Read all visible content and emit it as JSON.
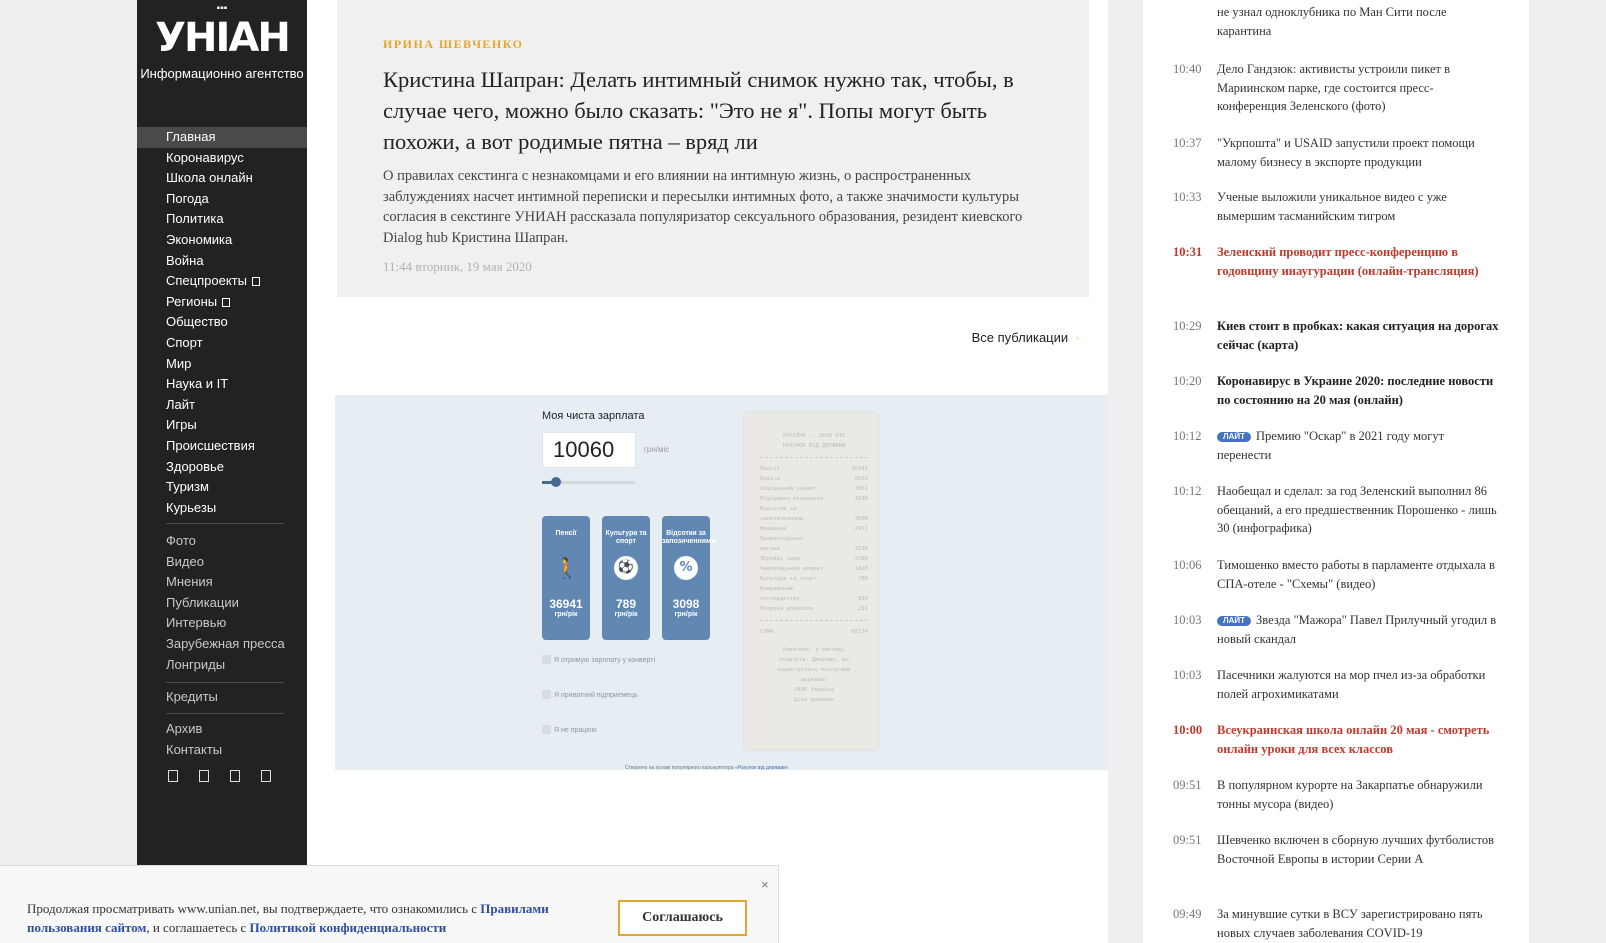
{
  "brand": {
    "logo": "УНІАН",
    "logo_dots": "▪▪▪",
    "subtitle": "Информационно агентство"
  },
  "sidebar": {
    "main_nav": [
      {
        "label": "Главная",
        "active": true
      },
      {
        "label": "Коронавирус"
      },
      {
        "label": "Школа онлайн"
      },
      {
        "label": "Погода"
      },
      {
        "label": "Политика"
      },
      {
        "label": "Экономика"
      },
      {
        "label": "Война"
      },
      {
        "label": "Спецпроекты",
        "submenu": true
      },
      {
        "label": "Регионы",
        "submenu": true
      },
      {
        "label": "Общество"
      },
      {
        "label": "Спорт"
      },
      {
        "label": "Мир"
      },
      {
        "label": "Наука и IT"
      },
      {
        "label": "Лайт"
      },
      {
        "label": "Игры"
      },
      {
        "label": "Происшествия"
      },
      {
        "label": "Здоровье"
      },
      {
        "label": "Туризм"
      },
      {
        "label": "Курьезы"
      }
    ],
    "secondary_nav": [
      "Фото",
      "Видео",
      "Мнения",
      "Публикации",
      "Интервью",
      "Зарубежная пресса",
      "Лонгриды"
    ],
    "credits": "Кредиты",
    "footer_nav": [
      "Архив",
      "Контакты"
    ]
  },
  "article": {
    "author": "Ирина Шевченко",
    "headline": "Кристина Шапран: Делать интимный снимок нужно так, чтобы, в случае чего, можно было сказать: \"Это не я\". Попы могут быть похожи, а вот родимые пятна – вряд ли",
    "lead": "О правилах секстинга с незнакомцами и его влиянии на интимную жизнь, о распространенных заблуждениях насчет интимной переписки и пересылки интимных фото, а также значимости культуры согласия в секстинге УНИАН рассказала популяризатор сексуального образования, резидент киевского Dialog hub Кристина Шапран.",
    "timestamp": "11:44 вторник, 19 мая 2020"
  },
  "all_publications": {
    "label": "Все публикации",
    "arrow": "▫"
  },
  "widget": {
    "label": "Моя чиста зарплата",
    "salary_value": "10060",
    "unit": "грн/міс",
    "slider_level": 0.15,
    "cards": [
      {
        "title": "Пенсії",
        "value": "36941",
        "unit": "грн/рік",
        "icon": "elderly-icon",
        "glyph": "🚶"
      },
      {
        "title": "Культура та спорт",
        "value": "789",
        "unit": "грн/рік",
        "icon": "ball-icon",
        "glyph": "⚽"
      },
      {
        "title": "Відсотки за запозиченнями",
        "value": "3098",
        "unit": "грн/рік",
        "icon": "percent-icon",
        "glyph": "%"
      }
    ],
    "checkboxes": [
      "Я отримую зарплату у конверті",
      "Я приватний підприємець",
      "Я не працюю"
    ],
    "receipt": {
      "header1": "УКРАЇНА -- 2020 РІК",
      "header2": "РАХУНОК ВІД ДЕРЖАВИ",
      "lines": [
        {
          "name": "Пенсії",
          "value": "36941"
        },
        {
          "name": "Освіта",
          "value": "5593"
        },
        {
          "name": "Соціальний захист",
          "value": "3051"
        },
        {
          "name": "Підтримка економіки",
          "value": "4030"
        },
        {
          "name": "Відсотки за",
          "value": ""
        },
        {
          "name": "запозиченнями",
          "value": "3098"
        },
        {
          "name": "Медицина",
          "value": "2971"
        },
        {
          "name": "Правоохоронні",
          "value": ""
        },
        {
          "name": "органи",
          "value": "3230"
        },
        {
          "name": "Збройні сили",
          "value": "2580"
        },
        {
          "name": "Чиновницький апарат",
          "value": "1620"
        },
        {
          "name": "Культура та спорт",
          "value": "789"
        },
        {
          "name": "Комунальне",
          "value": ""
        },
        {
          "name": "господарство",
          "value": "839"
        },
        {
          "name": "Охорона довкілля",
          "value": "231"
        }
      ],
      "total_label": "СУМА",
      "total_value": "65174",
      "footer_lines": [
        "Оплачено: у вигляді",
        "податків. Дякуємо, що",
        "користуєтесь послугами",
        "держави!",
        "СКОЄ Україна",
        "Ціна держави"
      ]
    },
    "footer_text": "Створено на основі популярного калькулятора",
    "footer_link": "«Рахунок від держави»"
  },
  "news": [
    {
      "time": "",
      "text": "не узнал одноклубника по Ман Сити после карантина",
      "style": "normal"
    },
    {
      "time": "10:40",
      "text": "Дело Гандзюк: активисты устроили пикет в Мариинском парке, где состоится пресс-конференция Зеленского (фото)",
      "style": "normal"
    },
    {
      "time": "10:37",
      "text": "\"Укрпошта\" и USAID запустили проект помощи малому бизнесу в экспорте продукции",
      "style": "normal"
    },
    {
      "time": "10:33",
      "text": "Ученые выложили уникальное видео с уже вымершим тасманийским тигром",
      "style": "normal"
    },
    {
      "time": "10:31",
      "text": "Зеленский проводит пресс-конференцию в годовщину инаугурации (онлайн-трансляция)",
      "style": "red"
    },
    {
      "time": "10:29",
      "text": "Киев стоит в пробках: какая ситуация на дорогах сейчас (карта)",
      "style": "bold"
    },
    {
      "time": "10:20",
      "text": "Коронавирус в Украине 2020: последние новости по состоянию на 20 мая (онлайн)",
      "style": "bold"
    },
    {
      "time": "10:12",
      "badge": "ЛАЙТ",
      "text": "Премию \"Оскар\" в 2021 году могут перенести",
      "style": "normal"
    },
    {
      "time": "10:12",
      "text": "Наобещал и сделал: за год Зеленский выполнил 86 обещаний, а его предшественник Порошенко - лишь 30 (инфографика)",
      "style": "normal"
    },
    {
      "time": "10:06",
      "text": "Тимошенко вместо работы в парламенте отдыхала в СПА-отеле - \"Схемы\" (видео)",
      "style": "normal"
    },
    {
      "time": "10:03",
      "badge": "ЛАЙТ",
      "text": "Звезда \"Мажора\" Павел Прилучный угодил в новый скандал",
      "style": "normal"
    },
    {
      "time": "10:03",
      "text": "Пасечники жалуются на мор пчел из-за обработки полей агрохимикатами",
      "style": "normal"
    },
    {
      "time": "10:00",
      "text": "Всеукраинская школа онлайн 20 мая - смотреть онлайн уроки для всех классов",
      "style": "red"
    },
    {
      "time": "09:51",
      "text": "В популярном курорте на Закарпатье обнаружили тонны мусора (видео)",
      "style": "normal"
    },
    {
      "time": "09:51",
      "text": "Шевченко включен в сборную лучших футболистов Восточной Европы в истории Серии А",
      "style": "normal"
    },
    {
      "time": "09:49",
      "text": "За минувшие сутки в ВСУ зарегистрировано пять новых случаев заболевания COVID-19",
      "style": "normal"
    }
  ],
  "cookie": {
    "text_before": "Продолжая просматривать www.unian.net, вы подтверждаете, что ознакомились с ",
    "link_rules": "Правилами пользования сайтом",
    "text_middle": ", и соглашаетесь с ",
    "link_privacy": "Политикой конфиденциальности",
    "button": "Соглашаюсь",
    "close": "×"
  },
  "colors": {
    "sidebar_bg": "#222222",
    "accent": "#e4a72d",
    "urgent": "#c0392b",
    "link": "#2d4ea3"
  }
}
